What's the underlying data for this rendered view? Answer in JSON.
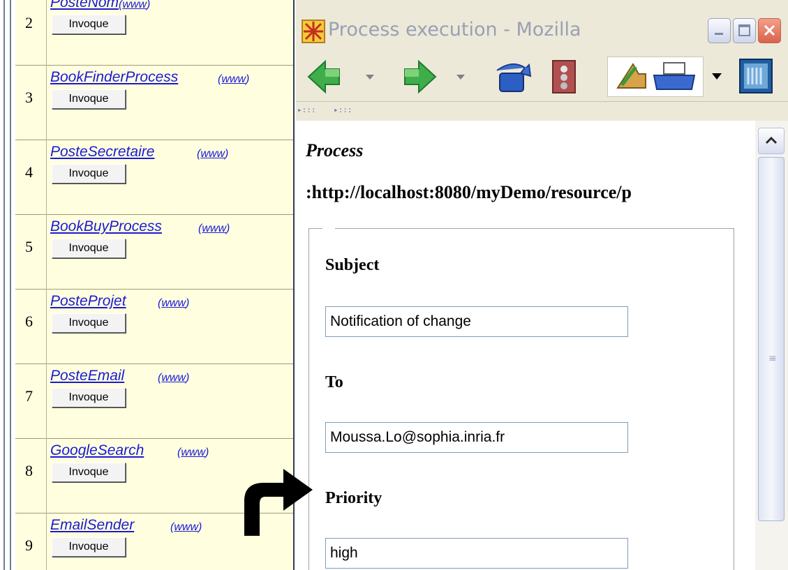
{
  "services": [
    {
      "num": "2",
      "name": "PosteNom",
      "www": "www",
      "button": "Invoque"
    },
    {
      "num": "3",
      "name": "BookFinderProcess",
      "www": "www",
      "button": "Invoque"
    },
    {
      "num": "4",
      "name": "PosteSecretaire",
      "www": "www",
      "button": "Invoque"
    },
    {
      "num": "5",
      "name": "BookBuyProcess",
      "www": "www",
      "button": "Invoque"
    },
    {
      "num": "6",
      "name": "PosteProjet",
      "www": "www",
      "button": "Invoque"
    },
    {
      "num": "7",
      "name": "PosteEmail",
      "www": "www",
      "button": "Invoque"
    },
    {
      "num": "8",
      "name": "GoogleSearch",
      "www": "www",
      "button": "Invoque"
    },
    {
      "num": "9",
      "name": "EmailSender",
      "www": "www",
      "button": "Invoque"
    }
  ],
  "window": {
    "title": "Process execution - Mozilla"
  },
  "content": {
    "process_label": "Process",
    "process_url": ":http://localhost:8080/myDemo/resource/p",
    "fields": [
      {
        "label": "Subject",
        "value": "Notification of change"
      },
      {
        "label": "To",
        "value": "Moussa.Lo@sophia.inria.fr"
      },
      {
        "label": "Priority",
        "value": "high"
      }
    ]
  },
  "colors": {
    "list_background": "#ffffe0",
    "link": "#1a1ad6",
    "window_chrome": "#ece9d8",
    "close_button": "#d9624c"
  }
}
